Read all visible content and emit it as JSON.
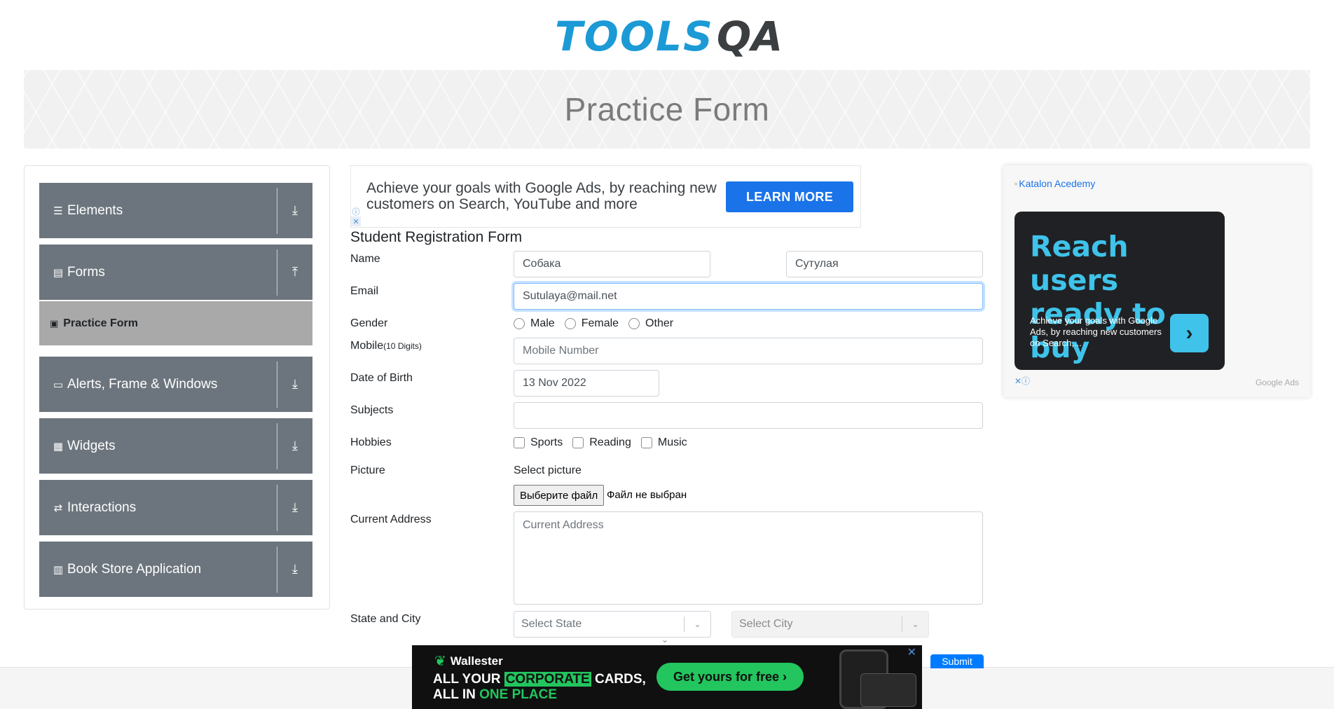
{
  "logo": {
    "part1": "TOOLS",
    "part2": "QA"
  },
  "banner": {
    "title": "Practice Form"
  },
  "sidebar": {
    "groups": [
      {
        "label": "Elements",
        "icon": "list-icon",
        "glyph": "☰",
        "arrow": "⤓"
      },
      {
        "label": "Forms",
        "icon": "form-icon",
        "glyph": "▤",
        "arrow": "⤒"
      },
      {
        "label": "Alerts, Frame & Windows",
        "icon": "window-icon",
        "glyph": "▭",
        "arrow": "⤓"
      },
      {
        "label": "Widgets",
        "icon": "widgets-icon",
        "glyph": "▦",
        "arrow": "⤓"
      },
      {
        "label": "Interactions",
        "icon": "interactions-icon",
        "glyph": "⇄",
        "arrow": "⤓"
      },
      {
        "label": "Book Store Application",
        "icon": "book-icon",
        "glyph": "▥",
        "arrow": "⤓"
      }
    ],
    "active_item": {
      "label": "Practice Form",
      "glyph": "▣"
    }
  },
  "top_ad": {
    "text": "Achieve your goals with Google Ads, by reaching new customers on Search, YouTube and more",
    "button": "LEARN MORE"
  },
  "form": {
    "title": "Student Registration Form",
    "name_label": "Name",
    "first_name": "Собака",
    "last_name": "Сутулая",
    "email_label": "Email",
    "email": "Sutulaya@mail.net",
    "gender_label": "Gender",
    "gender_options": [
      "Male",
      "Female",
      "Other"
    ],
    "mobile_label": "Mobile",
    "mobile_hint": "(10 Digits)",
    "mobile_placeholder": "Mobile Number",
    "dob_label": "Date of Birth",
    "dob": "13 Nov 2022",
    "subjects_label": "Subjects",
    "hobbies_label": "Hobbies",
    "hobbies": [
      "Sports",
      "Reading",
      "Music"
    ],
    "picture_label": "Picture",
    "picture_caption": "Select picture",
    "file_button": "Выберите файл",
    "file_status": "Файл не выбран",
    "address_label": "Current Address",
    "address_placeholder": "Current Address",
    "state_city_label": "State and City",
    "state_placeholder": "Select State",
    "city_placeholder": "Select City",
    "submit": "Submit"
  },
  "right_ad": {
    "image_alt": "Katalon Acedemy",
    "headline_1": "Reach users",
    "headline_2": "ready to buy",
    "body": "Achieve your goals with Google Ads, by reaching new customers on Search,...",
    "footer": "Google Ads"
  },
  "bottom_ad": {
    "brand": "Wallester",
    "line1_a": "ALL YOUR ",
    "line1_b": "CORPORATE",
    "line1_c": " CARDS,",
    "line2_a": "ALL IN ",
    "line2_b": "ONE PLACE",
    "cta": "Get yours for free ›"
  },
  "colors": {
    "sidebar_bg": "#6c757d",
    "active_item_bg": "#a9a9a9",
    "accent": "#1b9ad6",
    "ad_button": "#1a73e8",
    "wallester_green": "#22c55e"
  }
}
